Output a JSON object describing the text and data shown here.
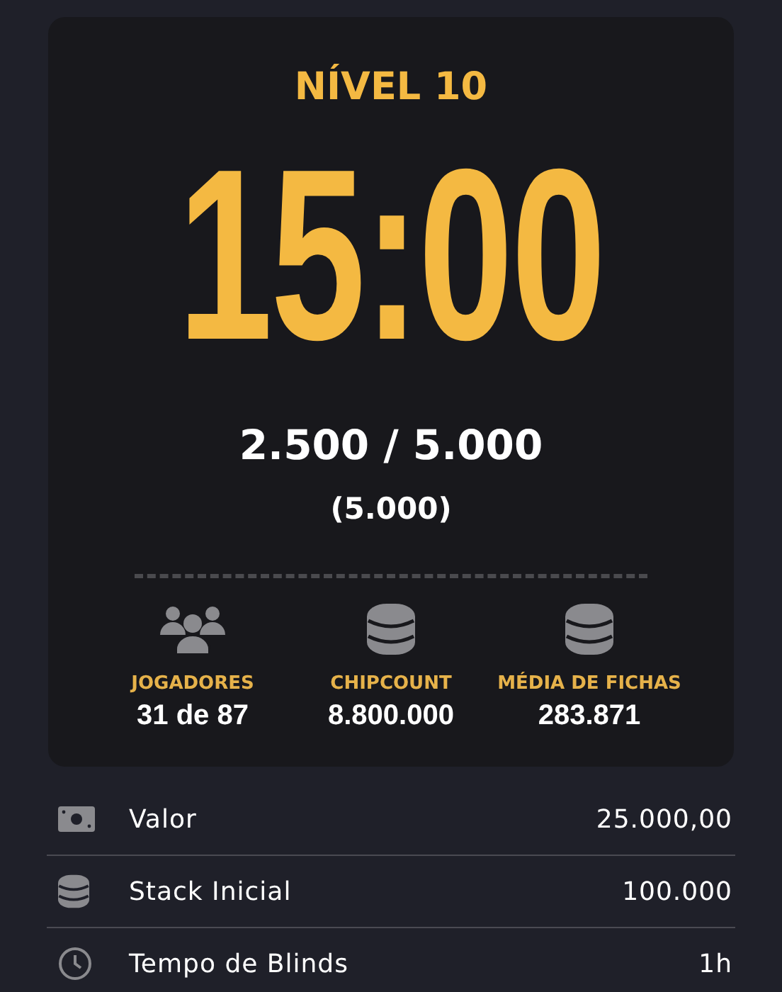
{
  "level_title": "NÍVEL 10",
  "timer": "15:00",
  "blinds": "2.500 / 5.000",
  "ante": "(5.000)",
  "stats": [
    {
      "kind": "people",
      "label": "JOGADORES",
      "value": "31 de 87"
    },
    {
      "kind": "chips",
      "label": "CHIPCOUNT",
      "value": "8.800.000"
    },
    {
      "kind": "chips",
      "label": "MÉDIA DE FICHAS",
      "value": "283.871"
    }
  ],
  "info_rows": [
    {
      "kind": "money",
      "label": "Valor",
      "value": "25.000,00"
    },
    {
      "kind": "chips",
      "label": "Stack Inicial",
      "value": "100.000"
    },
    {
      "kind": "clock",
      "label": "Tempo de Blinds",
      "value": "1h"
    }
  ]
}
